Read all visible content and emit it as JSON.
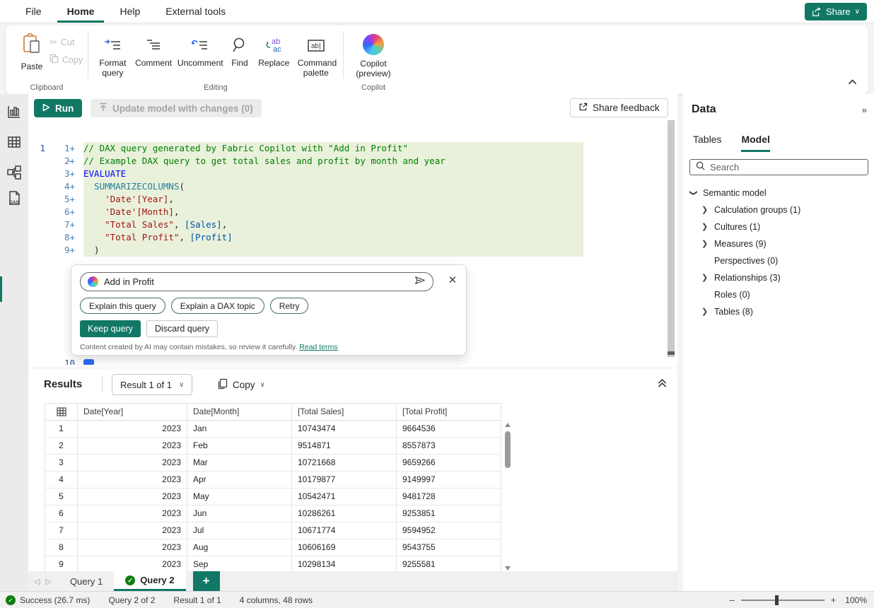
{
  "colors": {
    "accent": "#117865",
    "success_green": "#107c10",
    "diff_added_bg": "#e9f1db",
    "diff_removed_bg": "#f4abab"
  },
  "menu_bar": {
    "items": [
      "File",
      "Home",
      "Help",
      "External tools"
    ],
    "active": "Home",
    "share_label": "Share"
  },
  "ribbon": {
    "clipboard": {
      "group_label": "Clipboard",
      "paste": "Paste",
      "cut": "Cut",
      "copy": "Copy"
    },
    "editing": {
      "group_label": "Editing",
      "items": [
        {
          "label": "Format query",
          "icon": "format-query-icon"
        },
        {
          "label": "Comment",
          "icon": "comment-icon"
        },
        {
          "label": "Uncomment",
          "icon": "uncomment-icon"
        },
        {
          "label": "Find",
          "icon": "find-icon"
        },
        {
          "label": "Replace",
          "icon": "replace-icon"
        },
        {
          "label": "Command palette",
          "icon": "command-palette-icon"
        }
      ],
      "replace_icon_text_top": "ab",
      "replace_icon_text_bottom": "ac",
      "command_palette_icon_text": "ab|"
    },
    "copilot": {
      "group_label": "Copilot",
      "button_label": "Copilot (preview)"
    }
  },
  "toolbar": {
    "run_label": "Run",
    "update_model_label": "Update model with changes (0)",
    "share_feedback_label": "Share feedback"
  },
  "editor": {
    "deleted_line": {
      "old_num": "1",
      "marker": "−"
    },
    "lines": [
      {
        "num": "1+",
        "segs": [
          [
            "comment",
            "// DAX query generated by Fabric Copilot with \"Add in Profit\""
          ]
        ]
      },
      {
        "num": "2+",
        "segs": [
          [
            "comment",
            "// Example DAX query to get total sales and profit by month and year"
          ]
        ]
      },
      {
        "num": "3+",
        "segs": [
          [
            "keyword",
            "EVALUATE"
          ]
        ]
      },
      {
        "num": "4+",
        "segs": [
          [
            "plain",
            "  "
          ],
          [
            "func",
            "SUMMARIZECOLUMNS"
          ],
          [
            "plain",
            "("
          ]
        ]
      },
      {
        "num": "5+",
        "segs": [
          [
            "plain",
            "    "
          ],
          [
            "str",
            "'Date'[Year]"
          ],
          [
            "plain",
            ","
          ]
        ]
      },
      {
        "num": "6+",
        "segs": [
          [
            "plain",
            "    "
          ],
          [
            "str",
            "'Date'[Month]"
          ],
          [
            "plain",
            ","
          ]
        ]
      },
      {
        "num": "7+",
        "segs": [
          [
            "plain",
            "    "
          ],
          [
            "str",
            "\"Total Sales\""
          ],
          [
            "plain",
            ", "
          ],
          [
            "col",
            "[Sales]"
          ],
          [
            "plain",
            ","
          ]
        ]
      },
      {
        "num": "8+",
        "segs": [
          [
            "plain",
            "    "
          ],
          [
            "str",
            "\"Total Profit\""
          ],
          [
            "plain",
            ", "
          ],
          [
            "col",
            "[Profit]"
          ]
        ]
      },
      {
        "num": "9+",
        "segs": [
          [
            "plain",
            "  )"
          ]
        ]
      }
    ],
    "partial_line_num": "10"
  },
  "copilot_dialog": {
    "prompt_value": "Add in Profit",
    "close_glyph": "✕",
    "suggestions": [
      "Explain this query",
      "Explain a DAX topic",
      "Retry"
    ],
    "keep_label": "Keep query",
    "discard_label": "Discard query",
    "disclaimer": "Content created by AI may contain mistakes, so review it carefully.",
    "read_terms_label": "Read terms"
  },
  "results": {
    "title": "Results",
    "result_selector_label": "Result 1 of 1",
    "copy_label": "Copy",
    "chevron_glyph": "∨",
    "columns": [
      {
        "label": "Date[Year]",
        "align": "right"
      },
      {
        "label": "Date[Month]",
        "align": "left"
      },
      {
        "label": "[Total Sales]",
        "align": "left"
      },
      {
        "label": "[Total Profit]",
        "align": "left"
      }
    ],
    "rows": [
      [
        "1",
        "2023",
        "Jan",
        "10743474",
        "9664536"
      ],
      [
        "2",
        "2023",
        "Feb",
        "9514871",
        "8557873"
      ],
      [
        "3",
        "2023",
        "Mar",
        "10721668",
        "9659266"
      ],
      [
        "4",
        "2023",
        "Apr",
        "10179877",
        "9149997"
      ],
      [
        "5",
        "2023",
        "May",
        "10542471",
        "9481728"
      ],
      [
        "6",
        "2023",
        "Jun",
        "10286261",
        "9253851"
      ],
      [
        "7",
        "2023",
        "Jul",
        "10671774",
        "9594952"
      ],
      [
        "8",
        "2023",
        "Aug",
        "10606169",
        "9543755"
      ],
      [
        "9",
        "2023",
        "Sep",
        "10298134",
        "9255581"
      ]
    ]
  },
  "data_pane": {
    "title": "Data",
    "collapse_glyph": "»",
    "tabs": [
      "Tables",
      "Model"
    ],
    "active_tab": "Model",
    "search_placeholder": "Search",
    "tree": [
      {
        "label": "Semantic model",
        "level": 0,
        "expand": "down"
      },
      {
        "label": "Calculation groups (1)",
        "level": 1,
        "expand": "right"
      },
      {
        "label": "Cultures (1)",
        "level": 1,
        "expand": "right"
      },
      {
        "label": "Measures (9)",
        "level": 1,
        "expand": "right"
      },
      {
        "label": "Perspectives (0)",
        "level": 1,
        "expand": "none"
      },
      {
        "label": "Relationships (3)",
        "level": 1,
        "expand": "right"
      },
      {
        "label": "Roles (0)",
        "level": 1,
        "expand": "none"
      },
      {
        "label": "Tables (8)",
        "level": 1,
        "expand": "right"
      }
    ]
  },
  "query_tabs": {
    "prev_glyph": "◁",
    "next_glyph": "▷",
    "tabs": [
      {
        "label": "Query 1",
        "active": false
      },
      {
        "label": "Query 2",
        "active": true
      }
    ],
    "add_label": "+",
    "check_glyph": "✓"
  },
  "status_bar": {
    "check_glyph": "✓",
    "items": [
      "Success (26.7 ms)",
      "Query 2 of 2",
      "Result 1 of 1",
      "4 columns, 48 rows"
    ],
    "zoom_minus": "–",
    "zoom_plus": "+",
    "zoom_level": "100%"
  }
}
